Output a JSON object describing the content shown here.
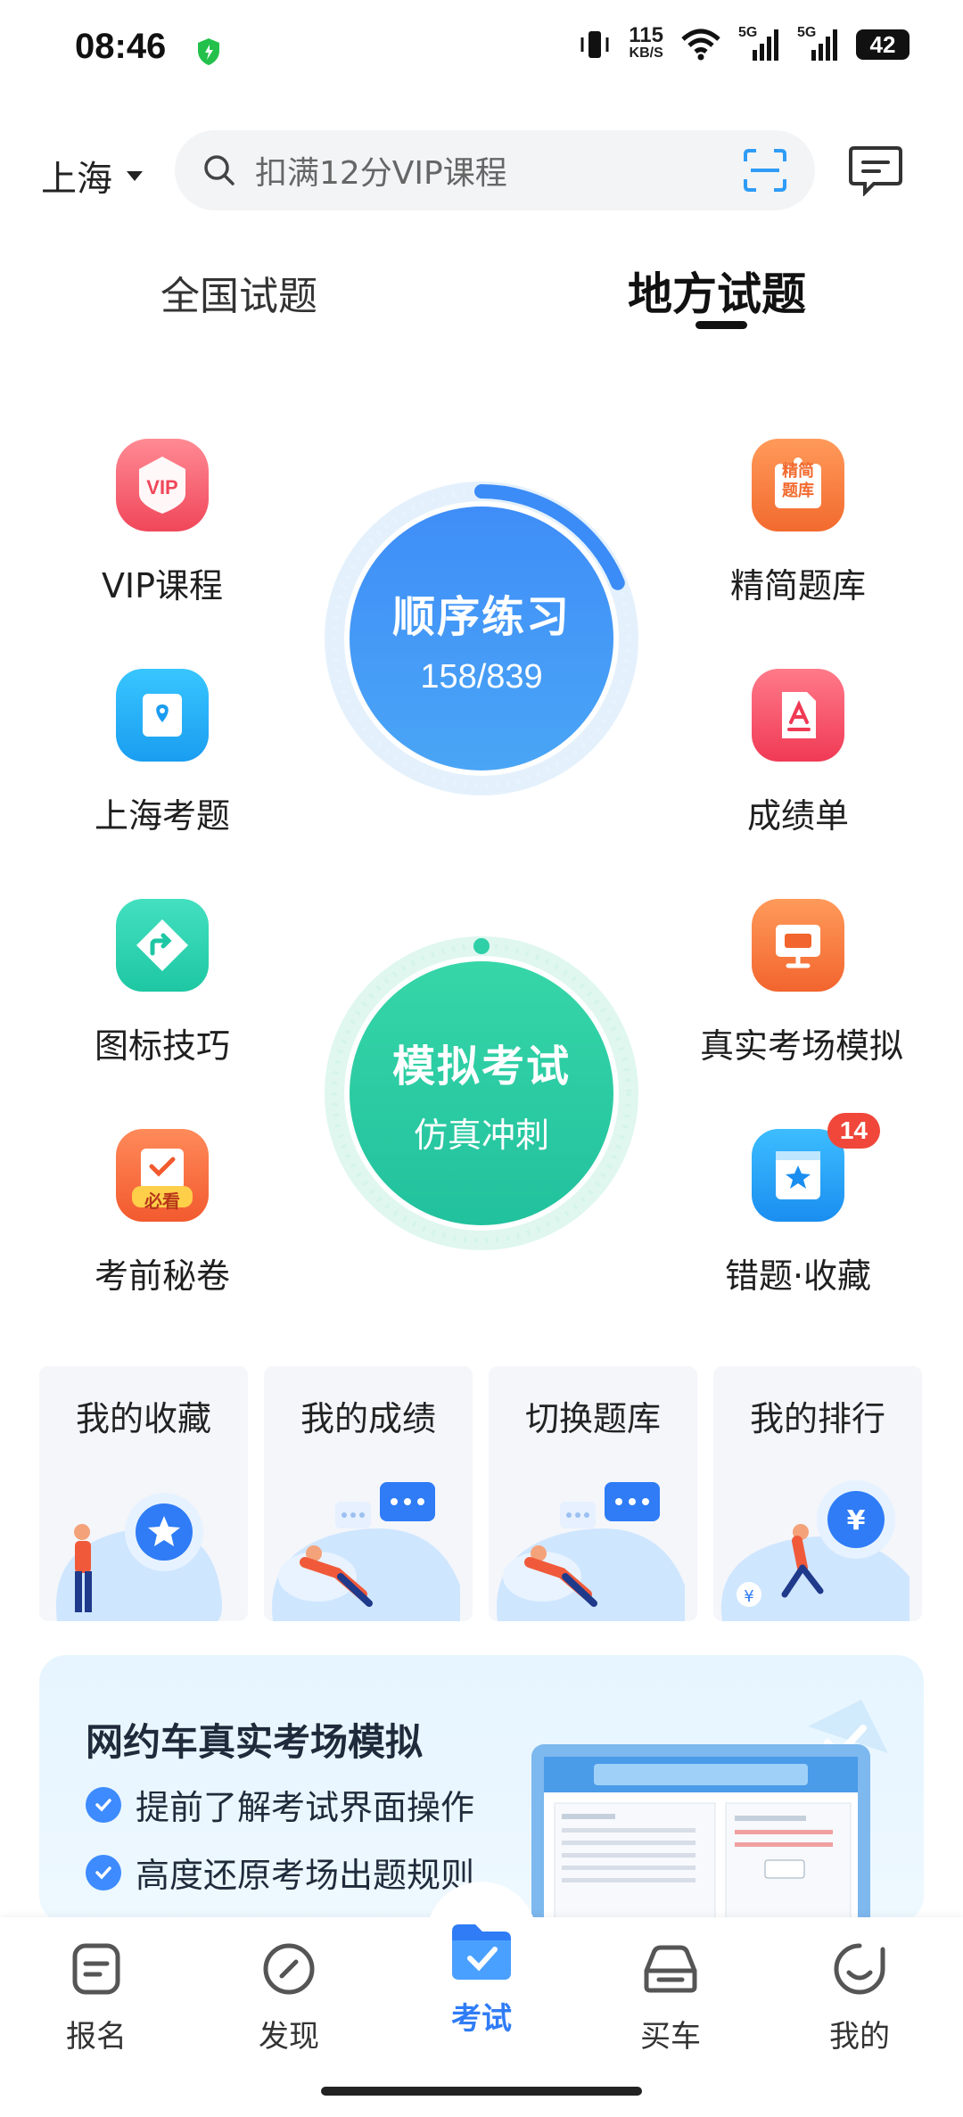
{
  "status_bar": {
    "time": "08:46",
    "net_speed_value": "115",
    "net_speed_unit": "KB/S",
    "sim1": "5G",
    "sim2": "5G",
    "battery": "42"
  },
  "header": {
    "city": "上海",
    "search_placeholder": "扣满12分VIP课程"
  },
  "tabs": [
    {
      "label": "全国试题",
      "active": false
    },
    {
      "label": "地方试题",
      "active": true
    }
  ],
  "features_left": [
    {
      "label": "VIP课程",
      "icon": "vip-icon"
    },
    {
      "label": "上海考题",
      "icon": "location-book-icon"
    },
    {
      "label": "图标技巧",
      "icon": "road-sign-icon"
    },
    {
      "label": "考前秘卷",
      "icon": "must-read-icon",
      "tag": "必看"
    }
  ],
  "features_right": [
    {
      "label": "精简题库",
      "icon": "question-bank-icon",
      "tag": "精简\n题库"
    },
    {
      "label": "成绩单",
      "icon": "report-card-icon"
    },
    {
      "label": "真实考场模拟",
      "icon": "monitor-icon"
    },
    {
      "label": "错题·收藏",
      "icon": "star-bookmark-icon",
      "badge": "14"
    }
  ],
  "practice": {
    "title": "顺序练习",
    "progress_text": "158/839",
    "progress_done": 158,
    "progress_total": 839
  },
  "mock_exam": {
    "title": "模拟考试",
    "subtitle": "仿真冲刺"
  },
  "cards": [
    {
      "label": "我的收藏"
    },
    {
      "label": "我的成绩"
    },
    {
      "label": "切换题库"
    },
    {
      "label": "我的排行"
    }
  ],
  "promo": {
    "title": "网约车真实考场模拟",
    "points": [
      "提前了解考试界面操作",
      "高度还原考场出题规则"
    ]
  },
  "bottom_nav": [
    {
      "label": "报名",
      "icon": "form-icon",
      "active": false
    },
    {
      "label": "发现",
      "icon": "compass-icon",
      "active": false
    },
    {
      "label": "考试",
      "icon": "exam-folder-icon",
      "active": true
    },
    {
      "label": "买车",
      "icon": "car-icon",
      "active": false
    },
    {
      "label": "我的",
      "icon": "profile-icon",
      "active": false
    }
  ],
  "colors": {
    "accent_blue": "#2f7cf6",
    "practice_blue": "#3b8cf7",
    "mock_green": "#2fd0a8",
    "badge_red": "#f0473a"
  }
}
